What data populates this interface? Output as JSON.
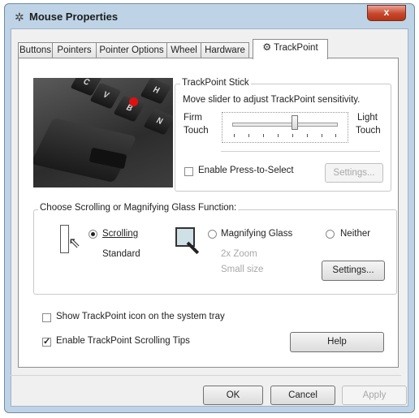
{
  "window": {
    "title": "Mouse Properties",
    "close_label": "x"
  },
  "tabs": [
    {
      "label": "Buttons"
    },
    {
      "label": "Pointers"
    },
    {
      "label": "Pointer Options"
    },
    {
      "label": "Wheel"
    },
    {
      "label": "Hardware"
    },
    {
      "label": "TrackPoint",
      "active": true
    }
  ],
  "keyboard_keys": [
    "C",
    "V",
    "B",
    "H",
    "N"
  ],
  "trackpoint_stick": {
    "group_label": "TrackPoint Stick",
    "description": "Move slider to adjust TrackPoint sensitivity.",
    "left_label": "Firm\nTouch",
    "left_line1": "Firm",
    "left_line2": "Touch",
    "right_line1": "Light",
    "right_line2": "Touch",
    "sensitivity": 0.6,
    "press_to_select_label": "Enable Press-to-Select",
    "press_to_select_checked": false,
    "settings_button": "Settings..."
  },
  "scroll_group": {
    "label": "Choose Scrolling or Magnifying Glass Function:",
    "scrolling_label": "Scrolling",
    "scrolling_selected": true,
    "scrolling_sub": "Standard",
    "magnifying_label": "Magnifying Glass",
    "magnifying_selected": false,
    "magnifying_zoom": "2x Zoom",
    "magnifying_size": "Small size",
    "neither_label": "Neither",
    "neither_selected": false,
    "settings_button": "Settings..."
  },
  "options": {
    "show_icon_label": "Show TrackPoint icon on the system tray",
    "show_icon_checked": false,
    "scroll_tips_label": "Enable TrackPoint Scrolling Tips",
    "scroll_tips_checked": true,
    "help_button": "Help"
  },
  "footer": {
    "ok": "OK",
    "cancel": "Cancel",
    "apply": "Apply"
  }
}
